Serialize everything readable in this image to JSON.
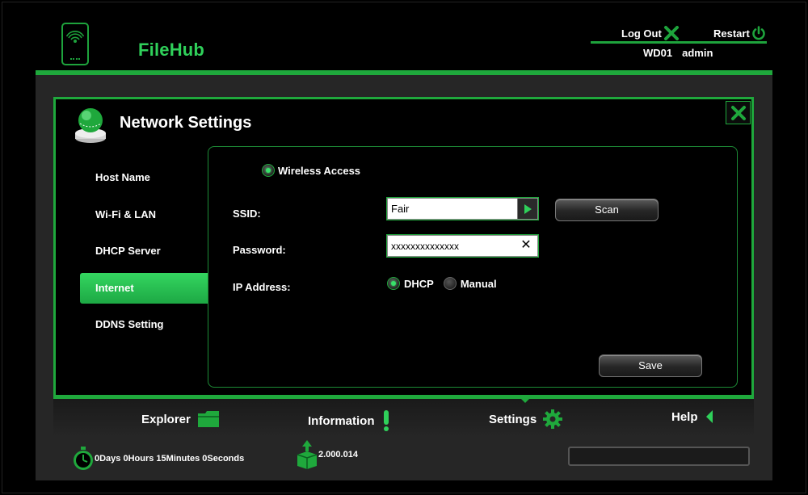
{
  "header": {
    "brand": "FileHub",
    "logout_label": "Log Out",
    "restart_label": "Restart",
    "device_name": "WD01",
    "user_name": "admin"
  },
  "section": {
    "title": "Network Settings"
  },
  "sidebar": {
    "items": [
      {
        "label": "Host Name",
        "active": false
      },
      {
        "label": "Wi-Fi & LAN",
        "active": false
      },
      {
        "label": "DHCP Server",
        "active": false
      },
      {
        "label": "Internet",
        "active": true
      },
      {
        "label": "DDNS Setting",
        "active": false
      }
    ]
  },
  "internet": {
    "mode_label": "Wireless Access",
    "ssid_label": "SSID:",
    "ssid_value": "Fair",
    "password_label": "Password:",
    "password_value": "xxxxxxxxxxxxxx",
    "scan_label": "Scan",
    "ip_label": "IP Address:",
    "ip_options": [
      {
        "label": "DHCP",
        "selected": true
      },
      {
        "label": "Manual",
        "selected": false
      }
    ],
    "save_label": "Save"
  },
  "bottom_nav": {
    "explorer": "Explorer",
    "information": "Information",
    "settings": "Settings",
    "help": "Help"
  },
  "status": {
    "uptime": "0Days 0Hours 15Minutes 0Seconds",
    "version": "2.000.014"
  },
  "colors": {
    "accent": "#1fa83c",
    "accent_light": "#34d660",
    "background": "#000000",
    "panel": "#262626"
  }
}
